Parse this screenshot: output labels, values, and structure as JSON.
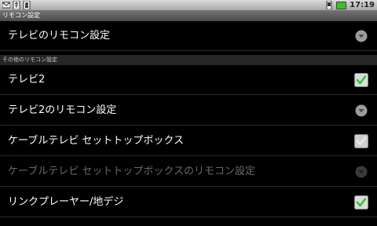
{
  "status_bar": {
    "time": "17:19"
  },
  "title": "リモコン設定",
  "rows_top": [
    {
      "label": "テレビのリモコン設定",
      "control": "more-icon"
    }
  ],
  "section_header": "その他のリモコン設定",
  "rows": [
    {
      "label": "テレビ2",
      "control": "checkbox",
      "checked": true,
      "enabled": true
    },
    {
      "label": "テレビ2のリモコン設定",
      "control": "more-icon",
      "enabled": true
    },
    {
      "label": "ケーブルテレビ セットトップボックス",
      "control": "checkbox",
      "checked": false,
      "enabled": true
    },
    {
      "label": "ケーブルテレビ セットトップボックスのリモコン設定",
      "control": "more-icon",
      "enabled": false
    },
    {
      "label": "リンクプレーヤー/地デジ",
      "control": "checkbox",
      "checked": true,
      "enabled": true
    }
  ],
  "colors": {
    "check_green": "#3cc23c",
    "accent_gray": "#9c9c9c"
  }
}
